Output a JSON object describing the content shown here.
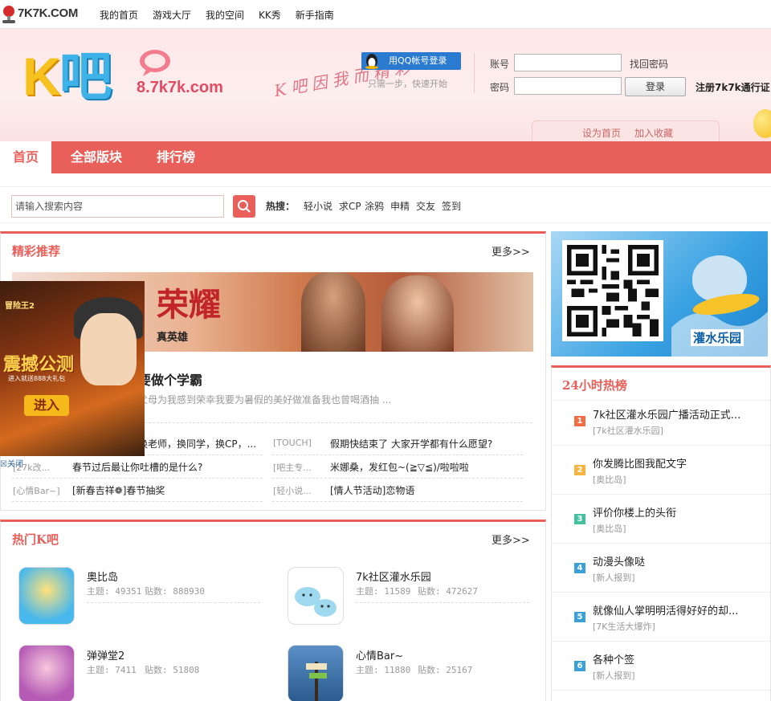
{
  "topbar": {
    "brand": "7K7K.COM",
    "nav": [
      "我的首页",
      "游戏大厅",
      "我的空间",
      "KK秀",
      "新手指南"
    ]
  },
  "header": {
    "logo_text": "K吧",
    "site": "8.7k7k.com",
    "slogan": "K吧因我而精彩",
    "qq_login": "用QQ帐号登录",
    "qq_sub": "只需一步，快速开始",
    "account_label": "账号",
    "password_label": "密码",
    "forgot": "找回密码",
    "login_button": "登录",
    "register": "注册7k7k通行证",
    "set_home": "设为首页",
    "add_fav": "加入收藏"
  },
  "mainnav": {
    "home": "首页",
    "items": [
      "全部版块",
      "排行榜"
    ]
  },
  "search": {
    "placeholder": "请输入搜索内容",
    "hot_label": "热搜：",
    "keywords": [
      "轻小说",
      "求CP",
      "涂鸦",
      "申精",
      "交友",
      "签到"
    ]
  },
  "featured": {
    "title": "精彩推荐",
    "more": "更多>>",
    "banner_title": "荣耀",
    "banner_sub": "真英雄",
    "headline": "要做个学霸",
    "summary": "父母为我感到荣幸我要为暑假的美好做准备我也曾喝酒抽 ...",
    "rows": [
      {
        "ltag": "",
        "ltext": "换老师，换同学，换CP，...",
        "rtag": "[TOUCH]",
        "rtext": "假期快结束了 大家开学都有什么愿望?"
      },
      {
        "ltag": "[27k改...",
        "ltext": "春节过后最让你吐槽的是什么?",
        "rtag": "[吧主专...",
        "rtext": "米娜桑，发红包~(≧▽≦)/啦啦啦"
      },
      {
        "ltag": "[心情Bar~]",
        "ltext": "[新春吉祥❁]春节抽奖",
        "rtag": "[轻小说...",
        "rtext": "[情人节活动]恋物语"
      }
    ]
  },
  "ad": {
    "logo": "冒险王2",
    "title": "震撼公测",
    "sub": "进入就送888大礼包",
    "button": "进入",
    "close": "关闭"
  },
  "hotk": {
    "title": "热门K吧",
    "more": "更多>>",
    "items": [
      {
        "name": "奥比岛",
        "topics": "主题: 49351",
        "posts": "贴数: 888930"
      },
      {
        "name": "7k社区灌水乐园",
        "topics": "主题: 11589",
        "posts": "贴数: 472627"
      },
      {
        "name": "弹弹堂2",
        "topics": "主题: 7411",
        "posts": "贴数: 51808"
      },
      {
        "name": "心情Bar~",
        "topics": "主题: 11880",
        "posts": "贴数: 25167"
      }
    ]
  },
  "qrcard": {
    "label": "灌水乐园"
  },
  "hot24": {
    "title": "24小时热榜",
    "items": [
      {
        "n": "1",
        "title": "7k社区灌水乐园广播活动正式...",
        "src": "[7k社区灌水乐园]"
      },
      {
        "n": "2",
        "title": "你发腾比图我配文字",
        "src": "[奥比岛]"
      },
      {
        "n": "3",
        "title": "评价你楼上的头衔",
        "src": "[奥比岛]"
      },
      {
        "n": "4",
        "title": "动漫头像哒",
        "src": "[新人报到]"
      },
      {
        "n": "5",
        "title": "就像仙人掌明明活得好好的却...",
        "src": "[7K生活大爆炸]"
      },
      {
        "n": "6",
        "title": "各种个签",
        "src": "[新人报到]"
      }
    ]
  },
  "colors": {
    "accent": "#e9605b",
    "rank1": "#f46c43",
    "rank2": "#f7b43e",
    "rank3": "#43c2a0",
    "rank4": "#3aa0d8",
    "rank5": "#3aa0d8",
    "rank6": "#3aa0d8"
  }
}
